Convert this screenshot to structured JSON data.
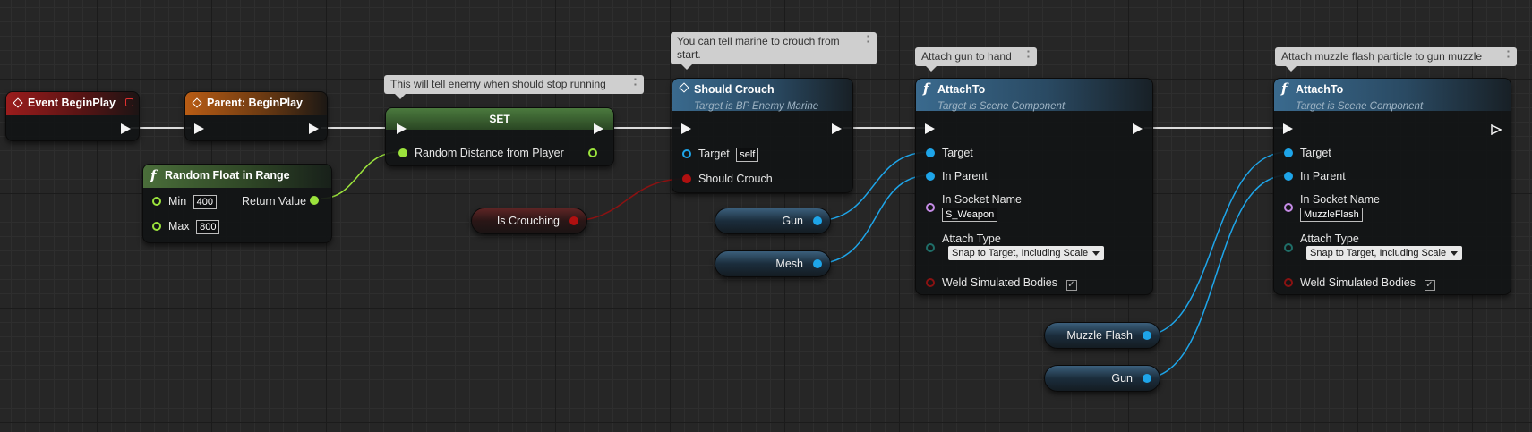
{
  "nodes": {
    "event_begin_play": {
      "title": "Event BeginPlay"
    },
    "parent_begin_play": {
      "title": "Parent: BeginPlay"
    },
    "set": {
      "title": "SET",
      "pin_label": "Random Distance from Player"
    },
    "random_float": {
      "title": "Random Float in Range",
      "min_label": "Min",
      "min_value": "400",
      "max_label": "Max",
      "max_value": "800",
      "return_label": "Return Value"
    },
    "should_crouch": {
      "title": "Should Crouch",
      "subtitle": "Target is BP Enemy Marine",
      "target_label": "Target",
      "target_value": "self",
      "crouch_label": "Should Crouch"
    },
    "attach_1": {
      "title": "AttachTo",
      "subtitle": "Target is Scene Component",
      "target_label": "Target",
      "parent_label": "In Parent",
      "socket_label": "In Socket Name",
      "socket_value": "S_Weapon",
      "attach_type_label": "Attach Type",
      "attach_type_value": "Snap to Target, Including Scale",
      "weld_label": "Weld Simulated Bodies",
      "weld_checked": "✓"
    },
    "attach_2": {
      "title": "AttachTo",
      "subtitle": "Target is Scene Component",
      "target_label": "Target",
      "parent_label": "In Parent",
      "socket_label": "In Socket Name",
      "socket_value": "MuzzleFlash",
      "attach_type_label": "Attach Type",
      "attach_type_value": "Snap to Target, Including Scale",
      "weld_label": "Weld Simulated Bodies",
      "weld_checked": "✓"
    }
  },
  "variables": {
    "is_crouching": "Is Crouching",
    "gun_1": "Gun",
    "mesh": "Mesh",
    "muzzle_flash": "Muzzle Flash",
    "gun_2": "Gun"
  },
  "comments": {
    "set_comment": "This will tell enemy when should stop running",
    "crouch_comment": "You can tell marine to crouch from start.",
    "attach1_comment": "Attach gun to hand",
    "attach2_comment": "Attach muzzle flash particle to gun muzzle"
  },
  "colors": {
    "exec": "#f4f4f4",
    "float_pin": "#9be33c",
    "object_pin": "#1ea5e9",
    "bool_pin": "#b01010",
    "name_pin": "#c58be6",
    "enum_pin": "#1f6e68"
  }
}
